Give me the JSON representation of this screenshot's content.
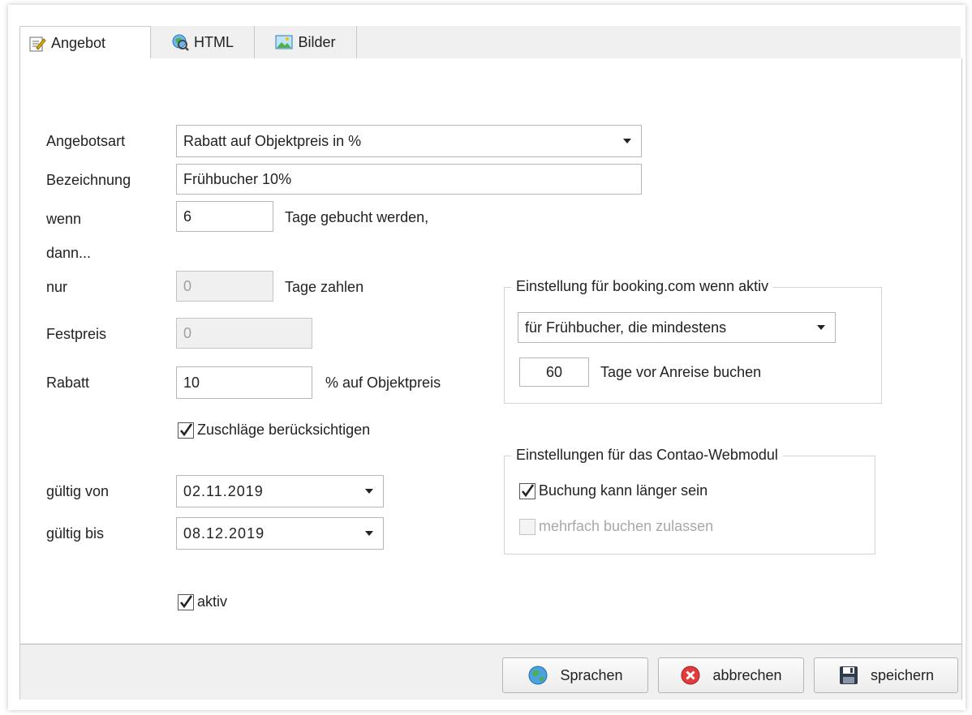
{
  "tabs": [
    {
      "label": "Angebot",
      "icon": "notepad-edit-icon",
      "active": true
    },
    {
      "label": "HTML",
      "icon": "globe-search-icon",
      "active": false
    },
    {
      "label": "Bilder",
      "icon": "picture-icon",
      "active": false
    }
  ],
  "form": {
    "angebotsart_label": "Angebotsart",
    "angebotsart_value": "Rabatt auf Objektpreis in %",
    "bezeichnung_label": "Bezeichnung",
    "bezeichnung_value": "Frühbucher 10%",
    "wenn_label": "wenn",
    "wenn_value": "6",
    "wenn_suffix": "Tage gebucht werden,",
    "dann_label": "dann...",
    "nur_label": "nur",
    "nur_value": "0",
    "nur_suffix": "Tage zahlen",
    "festpreis_label": "Festpreis",
    "festpreis_value": "0",
    "rabatt_label": "Rabatt",
    "rabatt_value": "10",
    "rabatt_suffix": "% auf Objektpreis",
    "zuschlaege_label": "Zuschläge berücksichtigen",
    "zuschlaege_checked": true,
    "gueltig_von_label": "gültig von",
    "gueltig_von_value": "02.11.2019",
    "gueltig_bis_label": "gültig bis",
    "gueltig_bis_value": "08.12.2019",
    "aktiv_label": "aktiv",
    "aktiv_checked": true
  },
  "booking_group": {
    "title": "Einstellung für booking.com wenn aktiv",
    "mode_value": "für Frühbucher, die mindestens",
    "days_value": "60",
    "days_suffix": "Tage vor Anreise buchen"
  },
  "contao_group": {
    "title": "Einstellungen für das Contao-Webmodul",
    "longer_label": "Buchung kann länger sein",
    "longer_checked": true,
    "multiple_label": "mehrfach buchen zulassen",
    "multiple_checked": false
  },
  "buttons": {
    "sprachen": "Sprachen",
    "abbrechen": "abbrechen",
    "speichern": "speichern"
  }
}
